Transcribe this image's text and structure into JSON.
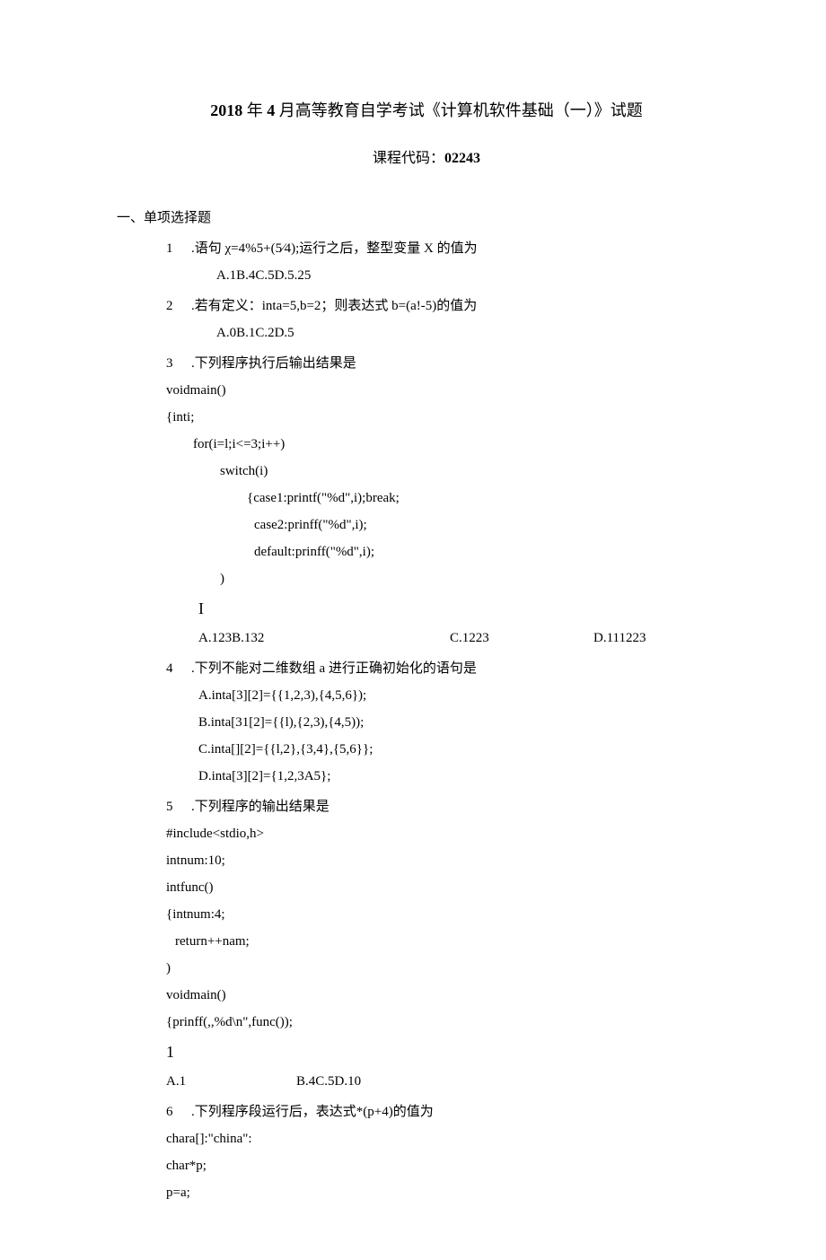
{
  "title": {
    "bold_prefix": "2018",
    "mid": " 年 ",
    "bold_month": "4",
    "rest": " 月高等教育自学考试《计算机软件基础（一）》试题"
  },
  "subtitle": {
    "label": "课程代码：",
    "code": "02243"
  },
  "section1": "一、单项选择题",
  "q1": {
    "num": "1",
    "text": ".语句 χ=4%5+(5⁄4);运行之后，整型变量 X 的值为",
    "opt": "A.1B.4C.5D.5.25"
  },
  "q2": {
    "num": "2",
    "text": ".若有定义：inta=5,b=2；则表达式 b=(a!-5)的值为",
    "opt": "A.0B.1C.2D.5"
  },
  "q3": {
    "num": "3",
    "text": ".下列程序执行后输出结果是",
    "c1": "voidmain()",
    "c2": "{inti;",
    "c3": "for(i=l;i<=3;i++)",
    "c4": "switch(i)",
    "c5": "{case1:printf(\"%d\",i);break;",
    "c6": "case2:prinff(\"%d\",i);",
    "c7": "default:prinff(\"%d\",i);",
    "c8": ")",
    "c9": "I",
    "optA": "A.123B.132",
    "optC": "C.1223",
    "optD": "D.111223"
  },
  "q4": {
    "num": "4",
    "text": ".下列不能对二维数组 a 进行正确初始化的语句是",
    "a": "A.inta[3][2]={{1,2,3),{4,5,6});",
    "b": "B.inta[31[2]={{l),{2,3),{4,5));",
    "c": "C.inta[][2]={{l,2},{3,4},{5,6}};",
    "d": "D.inta[3][2]={1,2,3A5};"
  },
  "q5": {
    "num": "5",
    "text": ".下列程序的输出结果是",
    "c1": "#include<stdio,h>",
    "c2": "intnum:10;",
    "c3": "intfunc()",
    "c4": "{intnum:4;",
    "c5": "return++nam;",
    "c6": ")",
    "c7": "voidmain()",
    "c8": "{prinff(,,%d\\n\",func());",
    "c9": "1",
    "optA": "A.1",
    "optB": "B.4C.5D.10"
  },
  "q6": {
    "num": "6",
    "text": ".下列程序段运行后，表达式*(p+4)的值为",
    "c1": "chara[]:\"china\":",
    "c2": "char*p;",
    "c3": "p=a;"
  }
}
